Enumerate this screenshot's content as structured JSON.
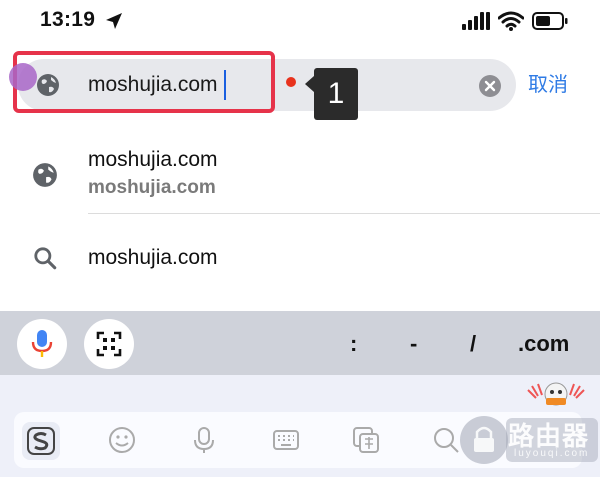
{
  "status_bar": {
    "time": "13:19"
  },
  "search": {
    "value": "moshujia.com",
    "cancel_label": "取消"
  },
  "annotation": {
    "step_number": "1"
  },
  "suggestions": [
    {
      "icon": "globe-icon",
      "title": "moshujia.com",
      "subtitle": "moshujia.com"
    },
    {
      "icon": "search-icon",
      "title": "moshujia.com"
    }
  ],
  "accessory_bar": {
    "keys": [
      ":",
      "-",
      "/",
      ".com"
    ]
  },
  "watermark": {
    "title": "路由器",
    "subtitle": "luyouqi.com"
  },
  "colors": {
    "highlight": "#e6334a",
    "cancel": "#2f7be5",
    "badge": "#2b2b2b"
  }
}
